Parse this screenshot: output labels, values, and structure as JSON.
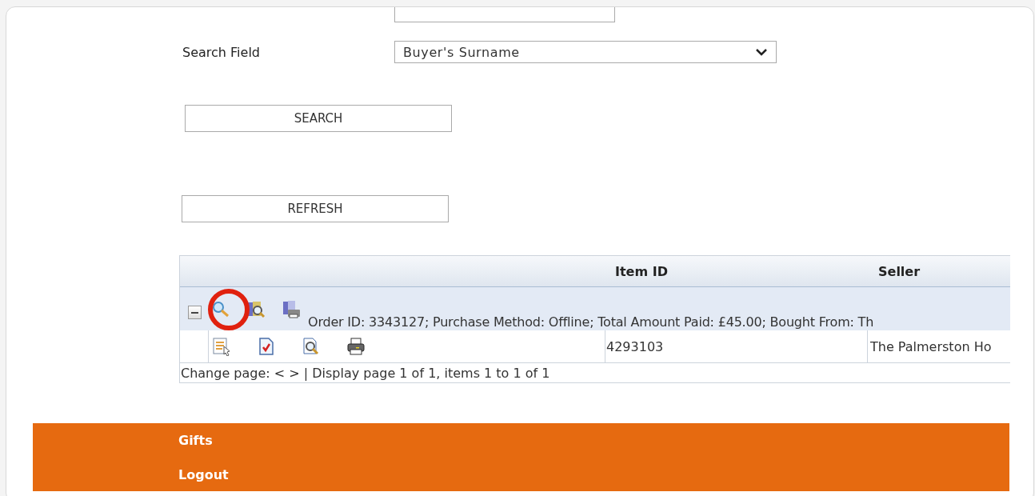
{
  "search_form": {
    "field_label": "Search Field",
    "field_value": "Buyer's Surname",
    "buttons": [
      "SEARCH",
      "REFRESH"
    ]
  },
  "table": {
    "columns": [
      "",
      "Item ID",
      "Seller"
    ],
    "group": {
      "expanded": true,
      "summary": "Order ID: 3343127; Purchase Method: Offline; Total Amount Paid: £45.00; Bought From: Th"
    },
    "rows": [
      {
        "item_id": "4293103",
        "seller": "The Palmerston Ho"
      }
    ],
    "pager": "Change page: < > | Display page 1 of 1, items 1 to 1 of 1"
  },
  "footer_menu": [
    "Gifts",
    "Logout"
  ]
}
